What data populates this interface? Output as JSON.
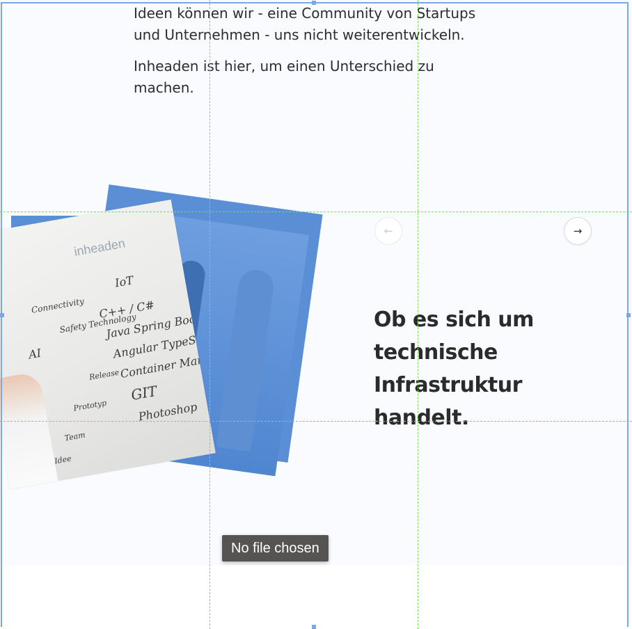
{
  "intro": {
    "paragraph1": "Ideen können wir - eine Community von Startups und Unternehmen - uns nicht weiterentwickeln.",
    "paragraph2": "Inheaden ist hier, um einen Unterschied zu machen."
  },
  "slider": {
    "prev_icon": "arrow-left-icon",
    "next_icon": "arrow-right-icon",
    "prev_symbol": "←",
    "next_symbol": "→"
  },
  "headline": "Ob es sich um technische Infrastruktur handelt.",
  "whiteboard": {
    "logo_text": "inheaden",
    "notes": [
      "C++ / C#",
      "Java Spring Boot",
      "Angular TypeScript",
      "Container Management",
      "GIT",
      "Photoshop"
    ],
    "bubbles": [
      "IoT",
      "AI",
      "Safety Technology",
      "Connectivity"
    ],
    "labels": [
      "Release",
      "Prototyp",
      "Team",
      "Idee"
    ]
  },
  "tooltip": "No file chosen",
  "colors": {
    "accent_blue": "#5a8fd6",
    "guide_green": "#7bd95a",
    "text_dark": "#2b2b2b",
    "section_bg": "#f9fbfe"
  }
}
